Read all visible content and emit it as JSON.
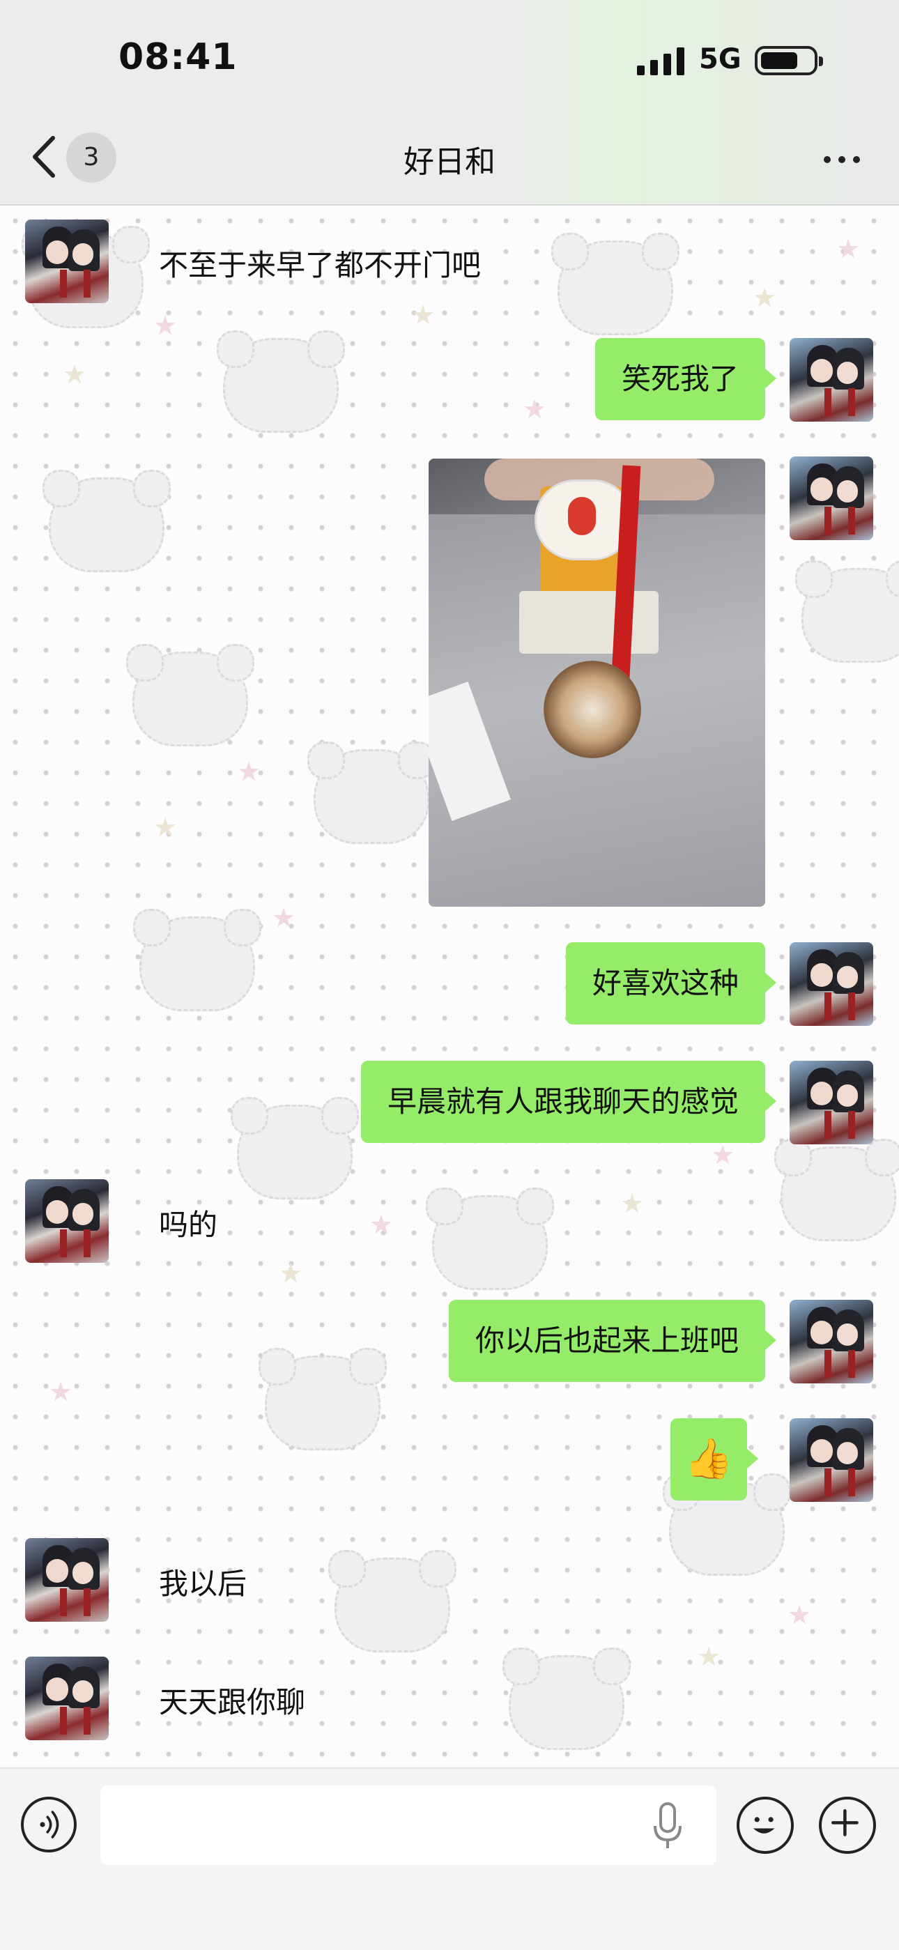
{
  "status_bar": {
    "time": "08:41",
    "network": "5G",
    "icons": [
      "signal-icon",
      "battery-icon"
    ]
  },
  "nav": {
    "back_icon": "chevron-left-icon",
    "unread_count": "3",
    "title": "好日和",
    "more_icon": "more-dots-icon"
  },
  "messages": [
    {
      "side": "left",
      "type": "text",
      "text": "不至于来早了都不开门吧"
    },
    {
      "side": "right",
      "type": "text",
      "text": "笑死我了"
    },
    {
      "side": "right",
      "type": "image",
      "description": "photo"
    },
    {
      "side": "right",
      "type": "text",
      "text": "好喜欢这种"
    },
    {
      "side": "right",
      "type": "text",
      "text": "早晨就有人跟我聊天的感觉"
    },
    {
      "side": "left",
      "type": "text",
      "text": "吗的"
    },
    {
      "side": "right",
      "type": "text",
      "text": "你以后也起来上班吧"
    },
    {
      "side": "right",
      "type": "emoji",
      "text": "👍"
    },
    {
      "side": "left",
      "type": "text",
      "text": "我以后"
    },
    {
      "side": "left",
      "type": "text",
      "text": "天天跟你聊"
    }
  ],
  "input_bar": {
    "voice_icon": "voice-mode-icon",
    "input_value": "",
    "mic_icon": "microphone-icon",
    "emoji_icon": "smiley-icon",
    "plus_icon": "plus-icon"
  },
  "colors": {
    "bubble_self": "#95ec69",
    "nav_bg": "#ececec"
  }
}
